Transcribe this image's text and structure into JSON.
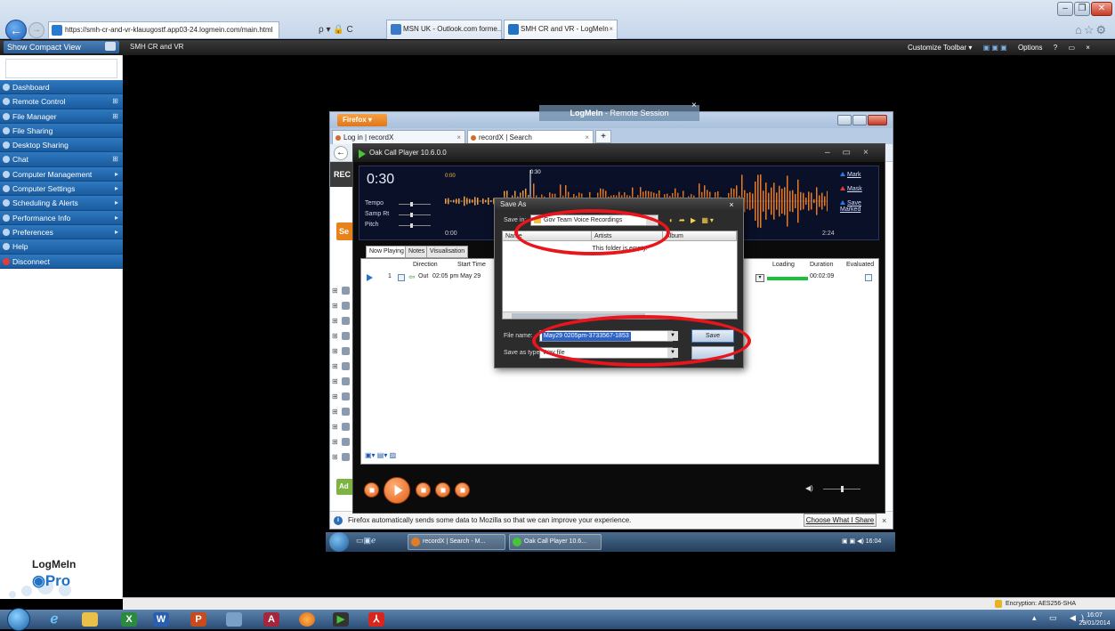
{
  "browser": {
    "url": "https://smh-cr-and-vr-klauugostf.app03-24.logmein.com/main.html",
    "address_controls": "ρ ▾ 🔒 C",
    "tabs": [
      {
        "label": "MSN UK - Outlook.com forme...",
        "close": ""
      },
      {
        "label": "SMH CR and VR - LogMeIn",
        "close": "×"
      }
    ],
    "right_icons": "⌂☆⚙"
  },
  "logmein": {
    "compact_view": "Show Compact View",
    "session_title": "SMH CR and VR",
    "toolbar_right": [
      "Customize Toolbar ▾",
      "Options",
      "?",
      "▭",
      "×"
    ],
    "menu": [
      {
        "label": "Dashboard",
        "arrow": ""
      },
      {
        "label": "Remote Control",
        "arrow": "⊞"
      },
      {
        "label": "File Manager",
        "arrow": "⊞"
      },
      {
        "label": "File Sharing",
        "arrow": ""
      },
      {
        "label": "Desktop Sharing",
        "arrow": ""
      },
      {
        "label": "Chat",
        "arrow": "⊞"
      },
      {
        "label": "Computer Management",
        "arrow": "▸"
      },
      {
        "label": "Computer Settings",
        "arrow": "▸"
      },
      {
        "label": "Scheduling & Alerts",
        "arrow": "▸"
      },
      {
        "label": "Performance Info",
        "arrow": "▸"
      },
      {
        "label": "Preferences",
        "arrow": "▸"
      },
      {
        "label": "Help",
        "arrow": ""
      },
      {
        "label": "Disconnect",
        "arrow": ""
      }
    ],
    "logo_top": "LogMeIn",
    "logo_bottom": "Pro",
    "encryption": "Encryption: AES256-SHA"
  },
  "remote": {
    "session_title_bold": "LogMeIn",
    "session_title_rest": " - Remote Session",
    "firefox": {
      "button": "Firefox ▾",
      "tabs": [
        "Log in | recordX",
        "recordX | Search"
      ],
      "new_tab": "+",
      "rec_label": "REC",
      "se_label": "Se",
      "ad_label": "Ad",
      "info_text": "Firefox automatically sends some data to Mozilla so that we can improve your experience.",
      "choose_button": "Choose What I Share",
      "info_close": "×"
    },
    "player": {
      "title": "Oak Call Player 10.6.0.0",
      "time": "0:30",
      "controls": [
        "Tempo",
        "Samp Rt",
        "Pitch"
      ],
      "start_time": "0:00",
      "end_time": "2:24",
      "marker_a": "0:00",
      "marker_b": "0:30",
      "links": [
        "Mark",
        "Mask",
        "Save Marked"
      ],
      "tabs": [
        "Now Playing",
        "Notes",
        "Visualisation"
      ],
      "columns": [
        "Direction",
        "Start Time",
        "Loading",
        "Duration",
        "Evaluated"
      ],
      "row": {
        "index": "1",
        "direction": "Out",
        "start": "02:05 pm May 29",
        "duration": "00:02:09"
      }
    },
    "save_as": {
      "title": "Save As",
      "save_in_label": "Save in:",
      "save_in_value": "Gov Team Voice Recordings",
      "columns": [
        "Name",
        "Artists",
        "Album"
      ],
      "empty_text": "This folder is empty.",
      "file_name_label": "File name:",
      "file_name_value": "May29 0205pm-3733567-1853",
      "save_type_label": "Save as type:",
      "save_type_value": "Wav file",
      "save_button": "Save",
      "close": "×"
    },
    "taskbar": {
      "tasks": [
        "recordX | Search - M...",
        "Oak Call Player 10.6..."
      ],
      "tray_time": "16:04"
    }
  },
  "os_taskbar": {
    "time": "16:07",
    "date": "29/01/2014",
    "icons": [
      "ie-icon",
      "folder-icon",
      "excel-icon",
      "word-icon",
      "powerpoint-icon",
      "app-icon",
      "access-icon",
      "firefox-icon",
      "player-icon",
      "pdf-icon"
    ]
  },
  "colors": {
    "menu_blue": "#1f66ad",
    "annotation_red": "#e8161c",
    "waveform": "#e87a20",
    "progress_green": "#19c23a"
  }
}
